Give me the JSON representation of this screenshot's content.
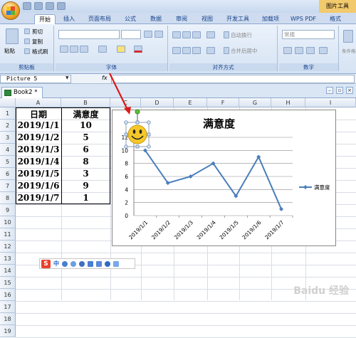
{
  "title_bar": {
    "context_tab": "图片工具"
  },
  "tabs": [
    "开始",
    "插入",
    "页面布局",
    "公式",
    "数据",
    "审阅",
    "视图",
    "开发工具",
    "加载项",
    "WPS PDF",
    "格式"
  ],
  "ribbon": {
    "clipboard": {
      "paste": "粘贴",
      "cut": "剪切",
      "copy": "复制",
      "format_painter": "格式刷",
      "group": "剪贴板"
    },
    "font": {
      "group": "字体"
    },
    "alignment": {
      "wrap": "自动换行",
      "merge": "合并后居中",
      "group": "对齐方式"
    },
    "number": {
      "format": "常规",
      "group": "数字"
    },
    "extra": {
      "label": "条件格"
    }
  },
  "formula_bar": {
    "name_box": "Picture 5",
    "fx": "fx"
  },
  "workbook": {
    "tab_label": "Book2 *"
  },
  "columns": [
    "A",
    "B",
    "C",
    "D",
    "E",
    "F",
    "G",
    "H",
    "I"
  ],
  "rows": [
    "1",
    "2",
    "3",
    "4",
    "5",
    "6",
    "7",
    "8",
    "9",
    "10",
    "11",
    "12",
    "13",
    "14",
    "15",
    "16",
    "17",
    "18",
    "19"
  ],
  "table": {
    "headers": [
      "日期",
      "满意度"
    ],
    "data": [
      [
        "2019/1/1",
        "10"
      ],
      [
        "2019/1/2",
        "5"
      ],
      [
        "2019/1/3",
        "6"
      ],
      [
        "2019/1/4",
        "8"
      ],
      [
        "2019/1/5",
        "3"
      ],
      [
        "2019/1/6",
        "9"
      ],
      [
        "2019/1/7",
        "1"
      ]
    ]
  },
  "chart_data": {
    "type": "line",
    "title": "满意度",
    "categories": [
      "2019/1/1",
      "2019/1/2",
      "2019/1/3",
      "2019/1/4",
      "2019/1/5",
      "2019/1/6",
      "2019/1/7"
    ],
    "series": [
      {
        "name": "满意度",
        "values": [
          10,
          5,
          6,
          8,
          3,
          9,
          1
        ]
      }
    ],
    "ylim": [
      0,
      12
    ],
    "yticks": [
      "0",
      "2",
      "4",
      "6",
      "8",
      "10",
      "12"
    ],
    "grid": true,
    "legend": "right",
    "line_color": "#4a7ebb"
  },
  "ime": {
    "logo": "S",
    "mode": "中"
  },
  "watermark": "Baidu 经验"
}
